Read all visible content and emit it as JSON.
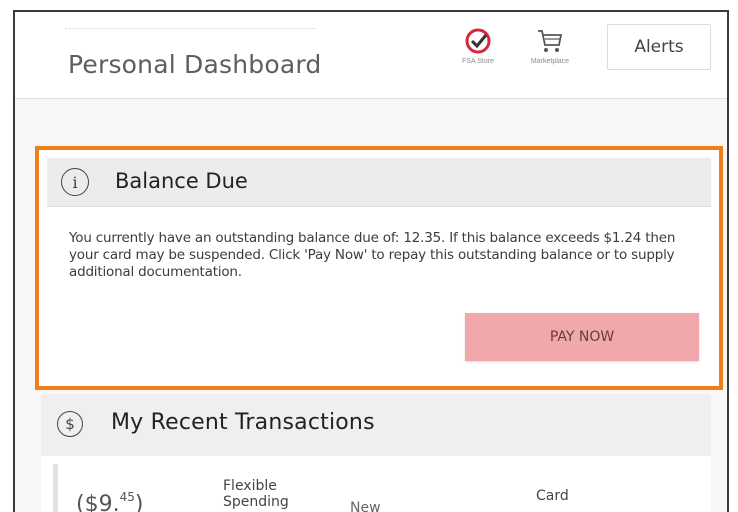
{
  "header": {
    "title": "Personal Dashboard",
    "icons": [
      {
        "name": "fsa-store-icon",
        "label": "FSA Store"
      },
      {
        "name": "marketplace-cart-icon",
        "label": "Marketplace"
      }
    ],
    "alerts_label": "Alerts"
  },
  "balance": {
    "title": "Balance Due",
    "message": "You currently have an outstanding balance due of: 12.35. If this balance exceeds $1.24 then your card may be suspended. Click 'Pay Now' to repay this outstanding balance or to supply additional documentation.",
    "pay_label": "PAY NOW",
    "highlight_color": "#ef7f1a",
    "button_color": "#f0a8ad"
  },
  "transactions": {
    "title": "My Recent Transactions",
    "rows": [
      {
        "amount_main": "($9.",
        "amount_cents": "45",
        "amount_close": ")",
        "account": "Flexible Spending",
        "status": "New",
        "type": "Card"
      }
    ]
  }
}
